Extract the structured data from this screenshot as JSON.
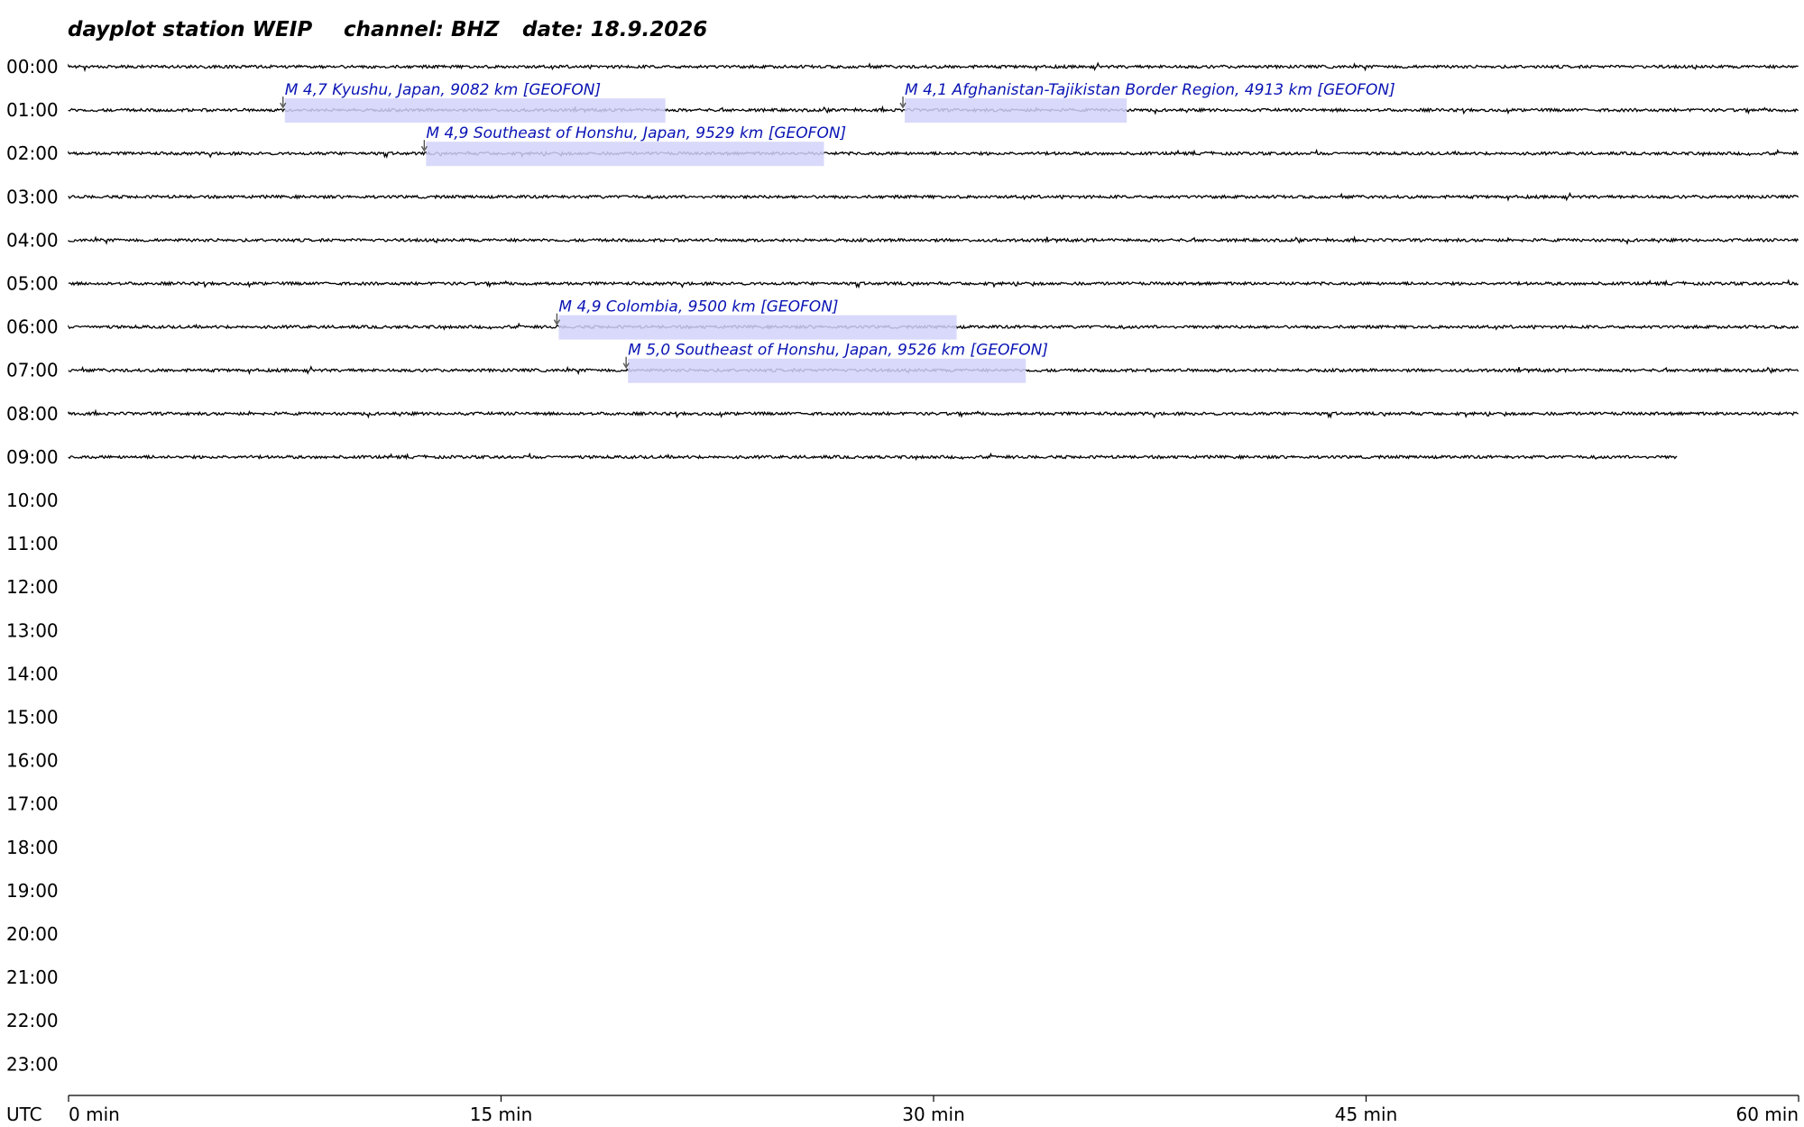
{
  "title": {
    "station": "dayplot station WEIP",
    "channel": "channel: BHZ",
    "date": "date: 18.9.2026"
  },
  "colors": {
    "trace": "#000000",
    "event_text": "#0a14b4",
    "event_box": "#d2d2fa",
    "marker": "#555555"
  },
  "chart_data": {
    "type": "dayplot",
    "x": {
      "unit": "min",
      "range": [
        0,
        60
      ],
      "ticks": [
        0,
        15,
        30,
        45,
        60
      ],
      "tick_labels": [
        "0 min",
        "15 min",
        "30 min",
        "45 min",
        "60 min"
      ],
      "corner_label": "UTC"
    },
    "rows": [
      "00:00",
      "01:00",
      "02:00",
      "03:00",
      "04:00",
      "05:00",
      "06:00",
      "07:00",
      "08:00",
      "09:00",
      "10:00",
      "11:00",
      "12:00",
      "13:00",
      "14:00",
      "15:00",
      "16:00",
      "17:00",
      "18:00",
      "19:00",
      "20:00",
      "21:00",
      "22:00",
      "23:00"
    ],
    "trace_rows": [
      {
        "hour": 0,
        "end_min": 60
      },
      {
        "hour": 1,
        "end_min": 60
      },
      {
        "hour": 2,
        "end_min": 60
      },
      {
        "hour": 3,
        "end_min": 60
      },
      {
        "hour": 4,
        "end_min": 60
      },
      {
        "hour": 5,
        "end_min": 60
      },
      {
        "hour": 6,
        "end_min": 60
      },
      {
        "hour": 7,
        "end_min": 60
      },
      {
        "hour": 8,
        "end_min": 60
      },
      {
        "hour": 9,
        "end_min": 55.8
      }
    ],
    "events": [
      {
        "hour": 1,
        "start_min": 7.5,
        "end_min": 20.7,
        "label": "M 4,7 Kyushu, Japan, 9082 km  [GEOFON]"
      },
      {
        "hour": 1,
        "start_min": 29.0,
        "end_min": 36.7,
        "label": "M 4,1 Afghanistan-Tajikistan Border Region, 4913 km  [GEOFON]"
      },
      {
        "hour": 2,
        "start_min": 12.4,
        "end_min": 26.2,
        "label": "M 4,9 Southeast of Honshu, Japan, 9529 km  [GEOFON]"
      },
      {
        "hour": 6,
        "start_min": 17.0,
        "end_min": 30.8,
        "label": "M 4,9 Colombia, 9500 km  [GEOFON]"
      },
      {
        "hour": 7,
        "start_min": 19.4,
        "end_min": 33.2,
        "label": "M 5,0 Southeast of Honshu, Japan, 9526 km  [GEOFON]"
      }
    ]
  }
}
